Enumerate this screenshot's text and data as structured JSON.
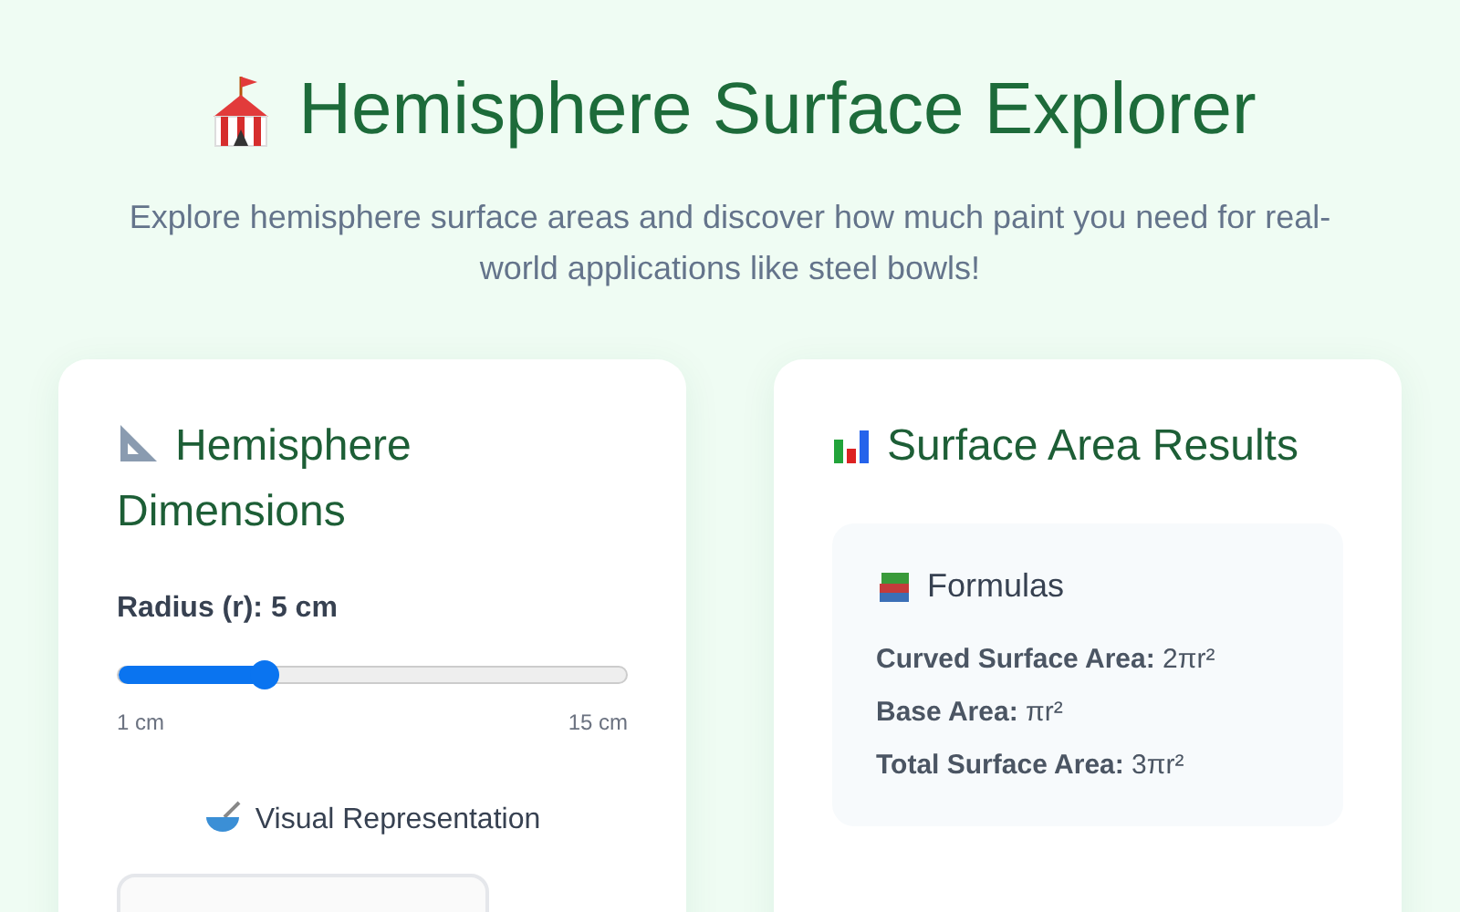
{
  "header": {
    "title": "Hemisphere Surface Explorer",
    "subtitle": "Explore hemisphere surface areas and discover how much paint you need for real-world applications like steel bowls!"
  },
  "dimensions_card": {
    "title": "Hemisphere Dimensions",
    "slider": {
      "label": "Radius (r): 5 cm",
      "level": 0.286,
      "min_label": "1 cm",
      "max_label": "15 cm"
    },
    "visual_title": "Visual Representation"
  },
  "results_card": {
    "title": "Surface Area Results",
    "formulas": {
      "title": "Formulas",
      "lines": [
        "**Curved Surface Area:** 2πr²",
        "**Base Area:** πr²",
        "**Total Surface Area:** 3πr²"
      ]
    }
  }
}
